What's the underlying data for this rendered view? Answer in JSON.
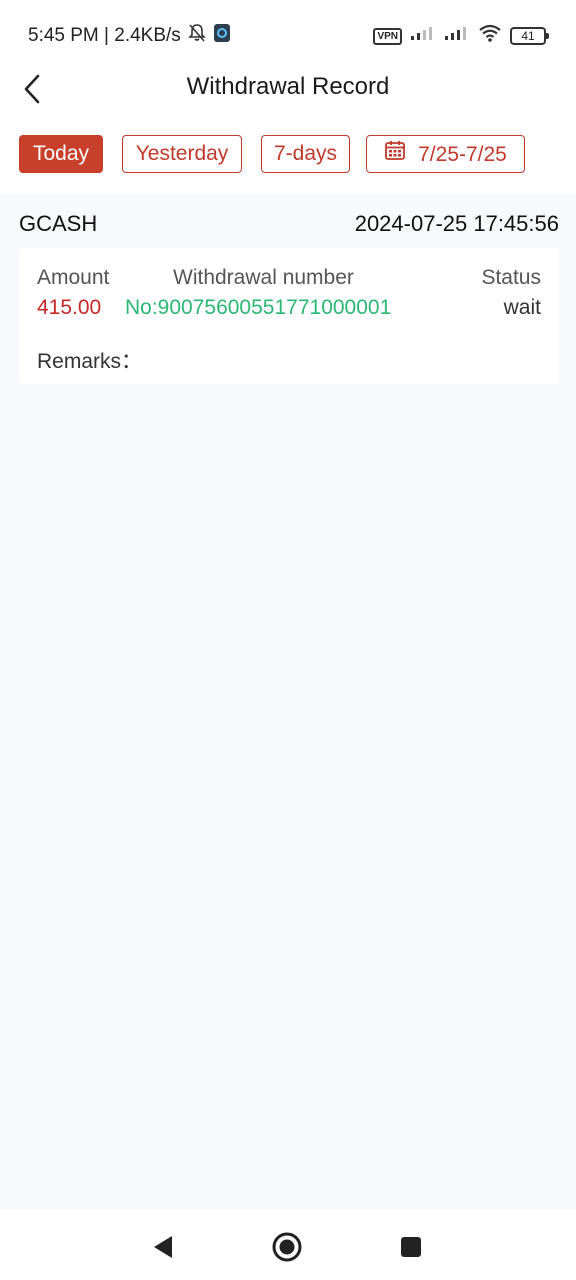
{
  "status_bar": {
    "time_speed": "5:45 PM | 2.4KB/s",
    "vpn": "VPN",
    "battery": "41"
  },
  "header": {
    "title": "Withdrawal Record"
  },
  "filters": {
    "items": [
      {
        "label": "Today",
        "active": true
      },
      {
        "label": "Yesterday",
        "active": false
      },
      {
        "label": "7-days",
        "active": false
      }
    ],
    "date_range": "7/25-7/25"
  },
  "records": [
    {
      "channel": "GCASH",
      "datetime": "2024-07-25 17:45:56",
      "amount_label": "Amount",
      "amount": "415.00",
      "number_label": "Withdrawal number",
      "number": "No:90075600551771000001",
      "status_label": "Status",
      "status": "wait",
      "remarks_label": "Remarks："
    }
  ],
  "colors": {
    "accent": "#c8402b",
    "amount": "#c62828",
    "number": "#2bb673",
    "background": "#f8f9fc"
  },
  "icons": {
    "back": "chevron-left-icon",
    "calendar": "calendar-icon",
    "nav_back": "triangle-back-icon",
    "nav_home": "circle-home-icon",
    "nav_recent": "square-recent-icon"
  }
}
